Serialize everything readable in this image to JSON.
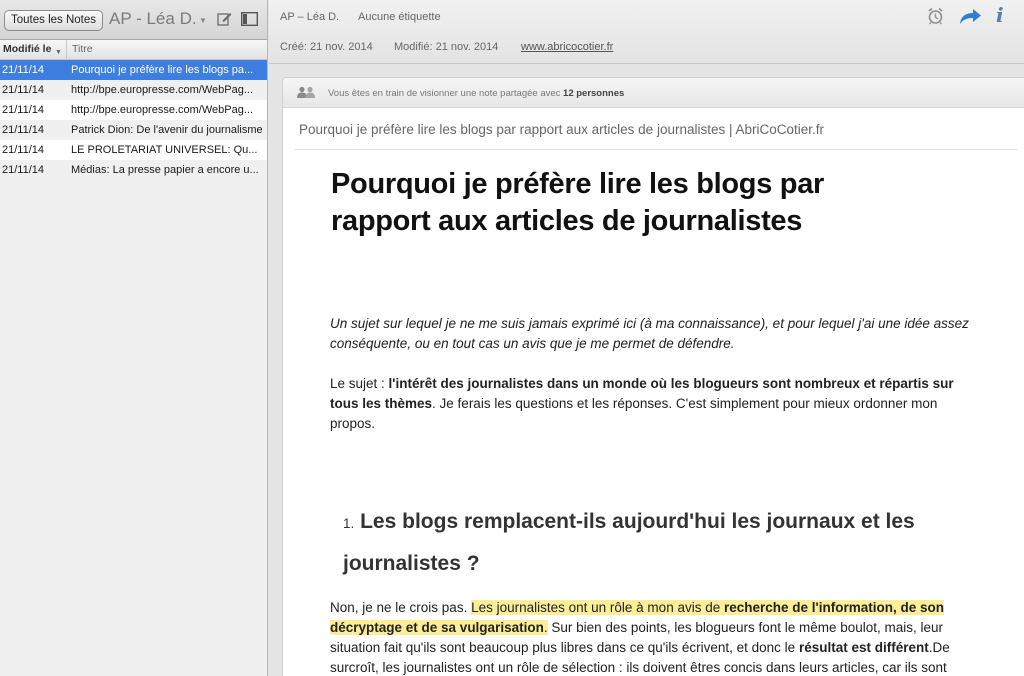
{
  "sidebar": {
    "all_notes_button": "Toutes les Notes",
    "notebook_name": "AP - Léa D.",
    "columns": {
      "date": "Modifié le",
      "title": "Titre"
    },
    "notes": [
      {
        "date": "21/11/14",
        "title": "Pourquoi je préfère lire les blogs pa...",
        "selected": true
      },
      {
        "date": "21/11/14",
        "title": "http://bpe.europresse.com/WebPag...",
        "selected": false
      },
      {
        "date": "21/11/14",
        "title": "http://bpe.europresse.com/WebPag...",
        "selected": false
      },
      {
        "date": "21/11/14",
        "title": "Patrick Dion: De l'avenir du journalisme",
        "selected": false
      },
      {
        "date": "21/11/14",
        "title": "LE PROLETARIAT UNIVERSEL: Qu...",
        "selected": false
      },
      {
        "date": "21/11/14",
        "title": "Médias: La presse papier a encore u...",
        "selected": false
      }
    ]
  },
  "note_meta": {
    "owner": "AP – Léa D.",
    "tags": "Aucune étiquette",
    "created": "Créé: 21 nov. 2014",
    "modified": "Modifié: 21 nov. 2014",
    "source_url": "www.abricocotier.fr"
  },
  "toolbar_icons": [
    "reminder-icon",
    "share-icon",
    "info-icon"
  ],
  "shared_banner": {
    "text": "Vous êtes en train de visionner une note partagée avec",
    "count": "12 personnes"
  },
  "note": {
    "title": "Pourquoi je préfère lire les blogs par rapport aux articles de journalistes | AbriCoCotier.fr",
    "heading": "Pourquoi je préfère lire les blogs par rapport aux articles de journalistes",
    "intro": "Un sujet sur lequel je ne me suis jamais exprimé ici (à ma connaissance), et pour lequel j'ai une idée assez conséquente, ou en tout cas un avis que je me permet de défendre.",
    "subject_prefix": "Le sujet : ",
    "subject_bold": "l'intérêt des journalistes dans un monde où les blogueurs sont nombreux et répartis sur tous les thèmes",
    "subject_rest": ". Je ferais les questions et les réponses. C'est simplement pour mieux ordonner mon propos.",
    "section_number": "1.",
    "section_heading": "Les blogs remplacent-ils aujourd'hui les journaux et les journalistes ?",
    "body_start": "Non, je ne le crois pas. ",
    "body_hl1": "Les journalistes ont un rôle à mon avis de ",
    "body_hl2_bold": "recherche de l'information, de son décryptage et de sa vulgarisation",
    "body_hl3": ".",
    "body_mid": " Sur bien des points, les blogueurs font le même boulot, mais, leur situation fait qu'ils sont beaucoup plus libres dans ce qu'ils écrivent, et donc le ",
    "body_bold2": "résultat est différent",
    "body_end": ".De surcroît, les journalistes ont un rôle de sélection : ils doivent êtres concis dans leurs articles, car ils sont"
  },
  "colors": {
    "selection": "#3d7ee0",
    "highlight": "#fbee96",
    "accent_blue": "#2f7fd8"
  }
}
